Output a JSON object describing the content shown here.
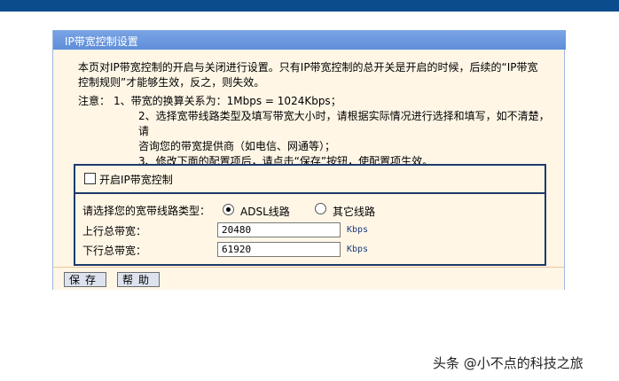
{
  "panel": {
    "title": "IP带宽控制设置",
    "intro": "本页对IP带宽控制的开启与关闭进行设置。只有IP带宽控制的总开关是开启的时候，后续的“IP带宽控制规则”才能够生效，反之，则失效。",
    "notes_label": "注意：",
    "notes": [
      "1、带宽的换算关系为：1Mbps = 1024Kbps；",
      "2、选择宽带线路类型及填写带宽大小时，请根据实际情况进行选择和填写，如不清楚，请",
      "咨询您的带宽提供商（如电信、网通等）；",
      "3、修改下面的配置项后，请点击“保存”按钮，使配置项生效。"
    ]
  },
  "control": {
    "enable_label": "开启IP带宽控制",
    "enable_checked": false,
    "line_type_label": "请选择您的宽带线路类型：",
    "line_options": [
      {
        "label": "ADSL线路",
        "selected": true
      },
      {
        "label": "其它线路",
        "selected": false
      }
    ],
    "upload_label": "上行总带宽：",
    "upload_value": "20480",
    "download_label": "下行总带宽：",
    "download_value": "61920",
    "unit": "Kbps"
  },
  "buttons": {
    "save": "保存",
    "help": "帮助"
  },
  "watermark": "头条 @小不点的科技之旅"
}
